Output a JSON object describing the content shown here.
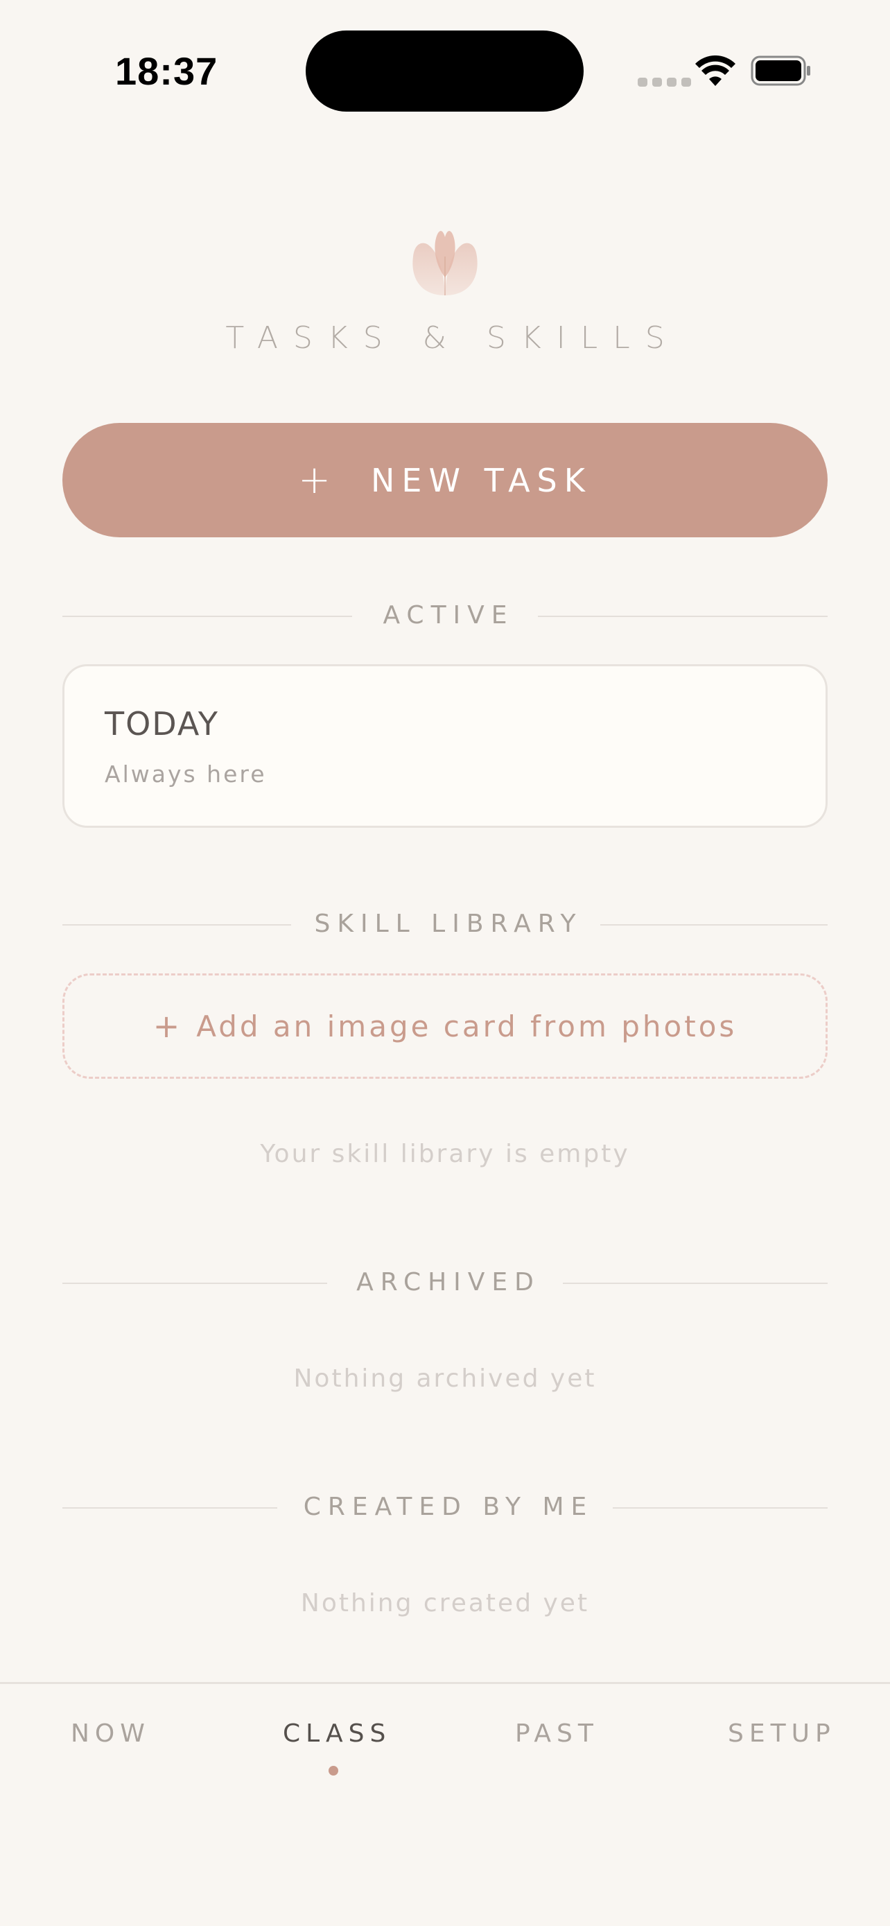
{
  "status_bar": {
    "time": "18:37"
  },
  "header": {
    "logo_icon": "tulip-icon",
    "title": "TASKS & SKILLS"
  },
  "new_task": {
    "plus": "+",
    "label": "NEW TASK"
  },
  "sections": {
    "active": "ACTIVE",
    "skill_library": "SKILL LIBRARY",
    "archived": "ARCHIVED",
    "created_by_me": "CREATED BY ME"
  },
  "today_card": {
    "title": "TODAY",
    "subtitle": "Always here"
  },
  "skill_library": {
    "add_plus": "+",
    "add_label": "Add an image card from photos",
    "empty": "Your skill library is empty"
  },
  "archived": {
    "empty": "Nothing archived yet"
  },
  "created": {
    "empty": "Nothing created yet"
  },
  "tabs": [
    {
      "label": "NOW",
      "active": false
    },
    {
      "label": "CLASS",
      "active": true
    },
    {
      "label": "PAST",
      "active": false
    },
    {
      "label": "SETUP",
      "active": false
    }
  ],
  "colors": {
    "background": "#f9f6f2",
    "accent": "#c99b8c",
    "card": "#fefcf8"
  }
}
